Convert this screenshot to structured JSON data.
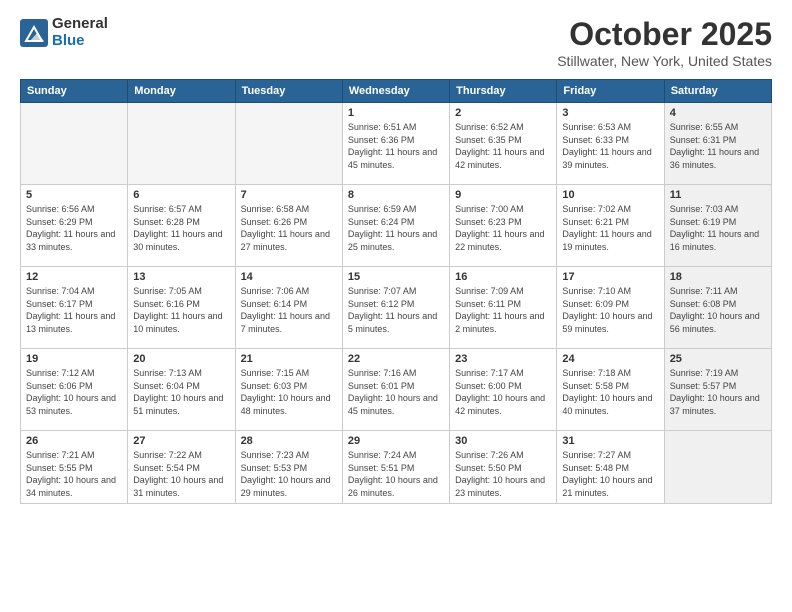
{
  "logo": {
    "general": "General",
    "blue": "Blue"
  },
  "title": "October 2025",
  "location": "Stillwater, New York, United States",
  "days_of_week": [
    "Sunday",
    "Monday",
    "Tuesday",
    "Wednesday",
    "Thursday",
    "Friday",
    "Saturday"
  ],
  "weeks": [
    [
      {
        "day": "",
        "info": "",
        "empty": true
      },
      {
        "day": "",
        "info": "",
        "empty": true
      },
      {
        "day": "",
        "info": "",
        "empty": true
      },
      {
        "day": "1",
        "info": "Sunrise: 6:51 AM\nSunset: 6:36 PM\nDaylight: 11 hours\nand 45 minutes."
      },
      {
        "day": "2",
        "info": "Sunrise: 6:52 AM\nSunset: 6:35 PM\nDaylight: 11 hours\nand 42 minutes."
      },
      {
        "day": "3",
        "info": "Sunrise: 6:53 AM\nSunset: 6:33 PM\nDaylight: 11 hours\nand 39 minutes."
      },
      {
        "day": "4",
        "info": "Sunrise: 6:55 AM\nSunset: 6:31 PM\nDaylight: 11 hours\nand 36 minutes.",
        "shaded": true
      }
    ],
    [
      {
        "day": "5",
        "info": "Sunrise: 6:56 AM\nSunset: 6:29 PM\nDaylight: 11 hours\nand 33 minutes."
      },
      {
        "day": "6",
        "info": "Sunrise: 6:57 AM\nSunset: 6:28 PM\nDaylight: 11 hours\nand 30 minutes."
      },
      {
        "day": "7",
        "info": "Sunrise: 6:58 AM\nSunset: 6:26 PM\nDaylight: 11 hours\nand 27 minutes."
      },
      {
        "day": "8",
        "info": "Sunrise: 6:59 AM\nSunset: 6:24 PM\nDaylight: 11 hours\nand 25 minutes."
      },
      {
        "day": "9",
        "info": "Sunrise: 7:00 AM\nSunset: 6:23 PM\nDaylight: 11 hours\nand 22 minutes."
      },
      {
        "day": "10",
        "info": "Sunrise: 7:02 AM\nSunset: 6:21 PM\nDaylight: 11 hours\nand 19 minutes."
      },
      {
        "day": "11",
        "info": "Sunrise: 7:03 AM\nSunset: 6:19 PM\nDaylight: 11 hours\nand 16 minutes.",
        "shaded": true
      }
    ],
    [
      {
        "day": "12",
        "info": "Sunrise: 7:04 AM\nSunset: 6:17 PM\nDaylight: 11 hours\nand 13 minutes."
      },
      {
        "day": "13",
        "info": "Sunrise: 7:05 AM\nSunset: 6:16 PM\nDaylight: 11 hours\nand 10 minutes."
      },
      {
        "day": "14",
        "info": "Sunrise: 7:06 AM\nSunset: 6:14 PM\nDaylight: 11 hours\nand 7 minutes."
      },
      {
        "day": "15",
        "info": "Sunrise: 7:07 AM\nSunset: 6:12 PM\nDaylight: 11 hours\nand 5 minutes."
      },
      {
        "day": "16",
        "info": "Sunrise: 7:09 AM\nSunset: 6:11 PM\nDaylight: 11 hours\nand 2 minutes."
      },
      {
        "day": "17",
        "info": "Sunrise: 7:10 AM\nSunset: 6:09 PM\nDaylight: 10 hours\nand 59 minutes."
      },
      {
        "day": "18",
        "info": "Sunrise: 7:11 AM\nSunset: 6:08 PM\nDaylight: 10 hours\nand 56 minutes.",
        "shaded": true
      }
    ],
    [
      {
        "day": "19",
        "info": "Sunrise: 7:12 AM\nSunset: 6:06 PM\nDaylight: 10 hours\nand 53 minutes."
      },
      {
        "day": "20",
        "info": "Sunrise: 7:13 AM\nSunset: 6:04 PM\nDaylight: 10 hours\nand 51 minutes."
      },
      {
        "day": "21",
        "info": "Sunrise: 7:15 AM\nSunset: 6:03 PM\nDaylight: 10 hours\nand 48 minutes."
      },
      {
        "day": "22",
        "info": "Sunrise: 7:16 AM\nSunset: 6:01 PM\nDaylight: 10 hours\nand 45 minutes."
      },
      {
        "day": "23",
        "info": "Sunrise: 7:17 AM\nSunset: 6:00 PM\nDaylight: 10 hours\nand 42 minutes."
      },
      {
        "day": "24",
        "info": "Sunrise: 7:18 AM\nSunset: 5:58 PM\nDaylight: 10 hours\nand 40 minutes."
      },
      {
        "day": "25",
        "info": "Sunrise: 7:19 AM\nSunset: 5:57 PM\nDaylight: 10 hours\nand 37 minutes.",
        "shaded": true
      }
    ],
    [
      {
        "day": "26",
        "info": "Sunrise: 7:21 AM\nSunset: 5:55 PM\nDaylight: 10 hours\nand 34 minutes."
      },
      {
        "day": "27",
        "info": "Sunrise: 7:22 AM\nSunset: 5:54 PM\nDaylight: 10 hours\nand 31 minutes."
      },
      {
        "day": "28",
        "info": "Sunrise: 7:23 AM\nSunset: 5:53 PM\nDaylight: 10 hours\nand 29 minutes."
      },
      {
        "day": "29",
        "info": "Sunrise: 7:24 AM\nSunset: 5:51 PM\nDaylight: 10 hours\nand 26 minutes."
      },
      {
        "day": "30",
        "info": "Sunrise: 7:26 AM\nSunset: 5:50 PM\nDaylight: 10 hours\nand 23 minutes."
      },
      {
        "day": "31",
        "info": "Sunrise: 7:27 AM\nSunset: 5:48 PM\nDaylight: 10 hours\nand 21 minutes."
      },
      {
        "day": "",
        "info": "",
        "empty": true,
        "shaded": true
      }
    ]
  ]
}
